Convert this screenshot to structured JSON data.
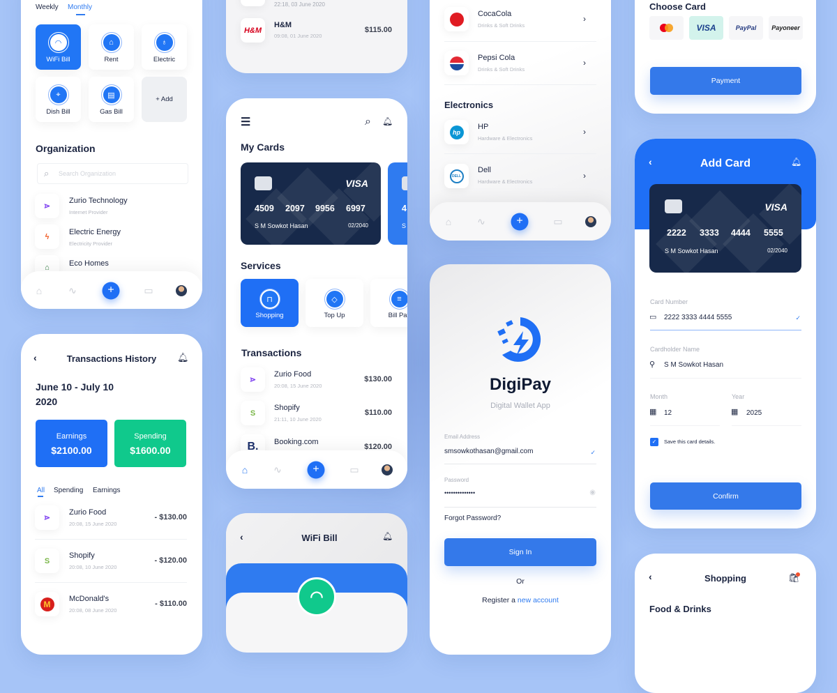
{
  "colors": {
    "accent": "#2176f5",
    "navy": "#17294a",
    "green": "#10c98c",
    "background": "#a6c4f7"
  },
  "bills": {
    "tabs": [
      "Weekly",
      "Monthly"
    ],
    "active_tab": "Monthly",
    "tiles": [
      {
        "label": "WiFi Bill",
        "icon": "wifi-icon"
      },
      {
        "label": "Rent",
        "icon": "house-icon"
      },
      {
        "label": "Electric",
        "icon": "bulb-icon"
      },
      {
        "label": "Dish Bill",
        "icon": "satellite-icon"
      },
      {
        "label": "Gas Bill",
        "icon": "gas-icon"
      }
    ],
    "add_label": "+ Add",
    "org_title": "Organization",
    "search_placeholder": "Search Organization",
    "orgs": [
      {
        "name": "Zurio Technology",
        "sub": "Internet Provider"
      },
      {
        "name": "Electric Energy",
        "sub": "Electricity Provider"
      },
      {
        "name": "Eco Homes",
        "sub": ""
      }
    ]
  },
  "history": {
    "title": "Transactions History",
    "range_line1": "June 10 - July 10",
    "range_line2": "2020",
    "earnings_label": "Earnings",
    "earnings_value": "$2100.00",
    "spending_label": "Spending",
    "spending_value": "$1600.00",
    "tabs": [
      "All",
      "Spending",
      "Earnings"
    ],
    "active_tab": "All",
    "rows": [
      {
        "name": "Zurio Food",
        "date": "20:08, 15 June 2020",
        "amount": "- $130.00"
      },
      {
        "name": "Shopify",
        "date": "20:08, 10 June 2020",
        "amount": "- $120.00"
      },
      {
        "name": "McDonald's",
        "date": "20:08, 08 June 2020",
        "amount": "- $110.00"
      }
    ]
  },
  "prev_list": {
    "partial_date": "22:18, 03 June 2020",
    "rows": [
      {
        "name": "H&M",
        "date": "09:08, 01 June 2020",
        "amount": "$115.00",
        "logo": "H&M"
      }
    ]
  },
  "home": {
    "my_cards_title": "My Cards",
    "card": {
      "brand": "VISA",
      "groups": [
        "4509",
        "2097",
        "9956",
        "6997"
      ],
      "holder": "S M Sowkot Hasan",
      "expiry": "02/2040"
    },
    "card2": {
      "first_digit": "4",
      "holder_initial": "S"
    },
    "services_title": "Services",
    "services": [
      {
        "label": "Shopping",
        "icon": "bag-icon"
      },
      {
        "label": "Top Up",
        "icon": "topup-icon"
      },
      {
        "label": "Bill Pay",
        "icon": "bill-icon"
      }
    ],
    "transactions_title": "Transactions",
    "transactions": [
      {
        "name": "Zurio Food",
        "date": "20:08, 15 June 2020",
        "amount": "$130.00"
      },
      {
        "name": "Shopify",
        "date": "21:11, 10 June 2020",
        "amount": "$110.00"
      },
      {
        "name": "Booking.com",
        "date": "",
        "amount": "$120.00",
        "logo": "B."
      }
    ]
  },
  "wifi": {
    "title": "WiFi Bill"
  },
  "shop_list": {
    "rows": [
      {
        "name": "CocaCola",
        "sub": "Drinks & Soft Drinks",
        "logo": "Coca-Cola"
      },
      {
        "name": "Pepsi Cola",
        "sub": "Drinks & Soft Drinks"
      }
    ],
    "section": "Electronics",
    "electronics": [
      {
        "name": "HP",
        "sub": "Hardware & Electronics",
        "logo": "hp"
      },
      {
        "name": "Dell",
        "sub": "Hardware & Electronics",
        "logo": "DELL"
      }
    ]
  },
  "login": {
    "app_name": "DigiPay",
    "tagline": "Digital Wallet App",
    "email_label": "Email Address",
    "email_value": "smsowkothasan@gmail.com",
    "password_label": "Password",
    "password_value": "••••••••••••••",
    "forgot": "Forgot Password?",
    "sign_in": "Sign In",
    "or": "Or",
    "register_prefix": "Register a ",
    "register_link": "new account"
  },
  "payment": {
    "title": "Choose Card",
    "methods": [
      "mastercard",
      "VISA",
      "PayPal",
      "Payoneer"
    ],
    "selected": "VISA",
    "button": "Payment"
  },
  "add_card": {
    "title": "Add Card",
    "card": {
      "brand": "VISA",
      "groups": [
        "2222",
        "3333",
        "4444",
        "5555"
      ],
      "holder": "S M Sowkot Hasan",
      "expiry": "02/2040"
    },
    "card_number_label": "Card Number",
    "card_number": "2222 3333 4444 5555",
    "holder_label": "Cardholder Name",
    "holder": "S M Sowkot Hasan",
    "month_label": "Month",
    "month": "12",
    "year_label": "Year",
    "year": "2025",
    "save_label": "Save this card details.",
    "save_checked": true,
    "confirm": "Confirm"
  },
  "shopping": {
    "title": "Shopping",
    "section": "Food & Drinks",
    "cart_badge_color": "#f0522e"
  }
}
